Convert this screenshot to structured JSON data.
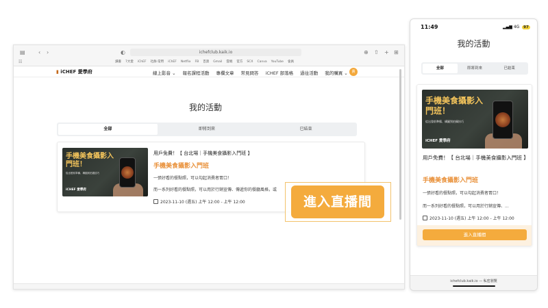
{
  "desktop": {
    "url": "ichefclub.kaik.io",
    "bookmarks": [
      "讀書",
      "7大愛",
      "iChEF",
      "社群-常用",
      "iChEF",
      "Netflix",
      "FB",
      "百貨",
      "Gmail",
      "雲端",
      "官方",
      "SCX",
      "Canva",
      "YouTube",
      "會員"
    ],
    "logo_text": "iCHEF 愛學府",
    "nav": [
      "線上影音",
      "報名課程活動",
      "專欄文章",
      "常見問答",
      "iCHEF 部落格",
      "過往活動",
      "我的購買"
    ],
    "avatar_initial": "貴",
    "page_title": "我的活動",
    "tabs": [
      "全部",
      "即將到來",
      "已結束"
    ],
    "card": {
      "kicker": "用戶免費！【 台北場｜手機美食攝影入門班 】",
      "title": "手機美食攝影入門班",
      "line1": "一張好看的餐點照，可以勾起消費者胃口！",
      "line2": "而一系列好看的餐點照，可以用於行銷宣傳、傳遞你的餐廳風格，或",
      "date": "2023-11-10 (週五) 上午 12:00 - 上午 12:00"
    },
    "live_button": "進入直播間"
  },
  "thumbnail": {
    "title": "手機美食攝影入門班！",
    "subtitle": "從出發前準備、構圖到拍攝技巧",
    "brand": "iCHEF 愛學府"
  },
  "mobile": {
    "time": "11:49",
    "network": "4G",
    "battery": "97",
    "page_title": "我的活動",
    "tabs": [
      "全部",
      "即將到來",
      "已結束"
    ],
    "card": {
      "kicker": "用戶免費！【 台北場｜手機美食攝影入門班 】",
      "title": "手機美食攝影入門班",
      "line1": "一張好看的餐點照，可以勾起消費者胃口！",
      "line2": "而一系列好看的餐點照，可以用於行銷宣傳、...",
      "date": "2023-11-10 (週五) 上午 12:00 - 上午 12:00"
    },
    "live_button": "進入直播間",
    "url": "ichefclub.kaik.io — 私密瀏覽"
  },
  "colors": {
    "accent": "#f4ab3d",
    "title_orange": "#e9913a"
  }
}
